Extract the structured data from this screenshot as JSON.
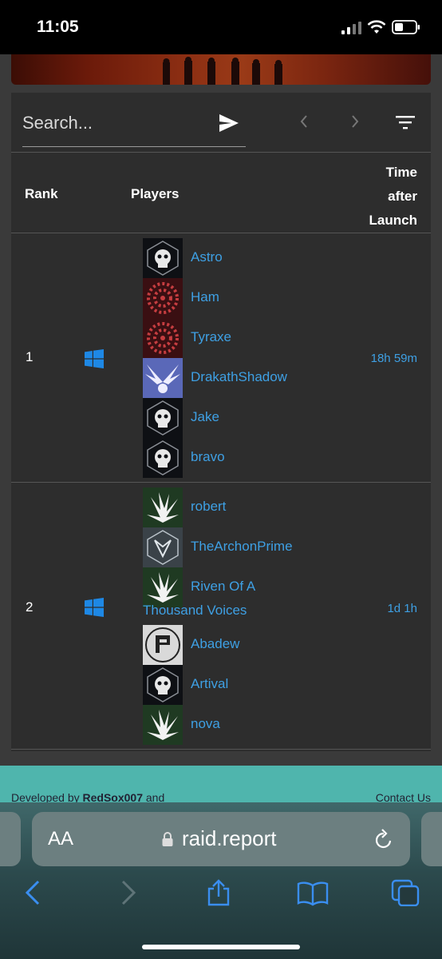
{
  "status_bar": {
    "time": "11:05"
  },
  "search": {
    "placeholder": "Search..."
  },
  "table": {
    "headers": {
      "rank": "Rank",
      "players": "Players",
      "time": "Time after Launch"
    },
    "rows": [
      {
        "rank": "1",
        "time": "18h 59m",
        "players": [
          "Astro",
          "Ham",
          "Tyraxe",
          "DrakathShadow",
          "Jake",
          "bravo"
        ]
      },
      {
        "rank": "2",
        "time": "1d 1h",
        "players": [
          "robert",
          "TheArchonPrime",
          "Riven Of A",
          "Thousand Voices",
          "Abadew",
          "Artival",
          "nova"
        ]
      }
    ]
  },
  "footer": {
    "developed_by": "Developed by",
    "developer": "RedSox007",
    "and": "and",
    "contact": "Contact Us"
  },
  "browser": {
    "text_size": "AA",
    "url": "raid.report"
  },
  "colors": {
    "link": "#3ea0e4",
    "card": "#2d2d2d",
    "footer": "#4fb5ad",
    "windows": "#1e88e5"
  }
}
